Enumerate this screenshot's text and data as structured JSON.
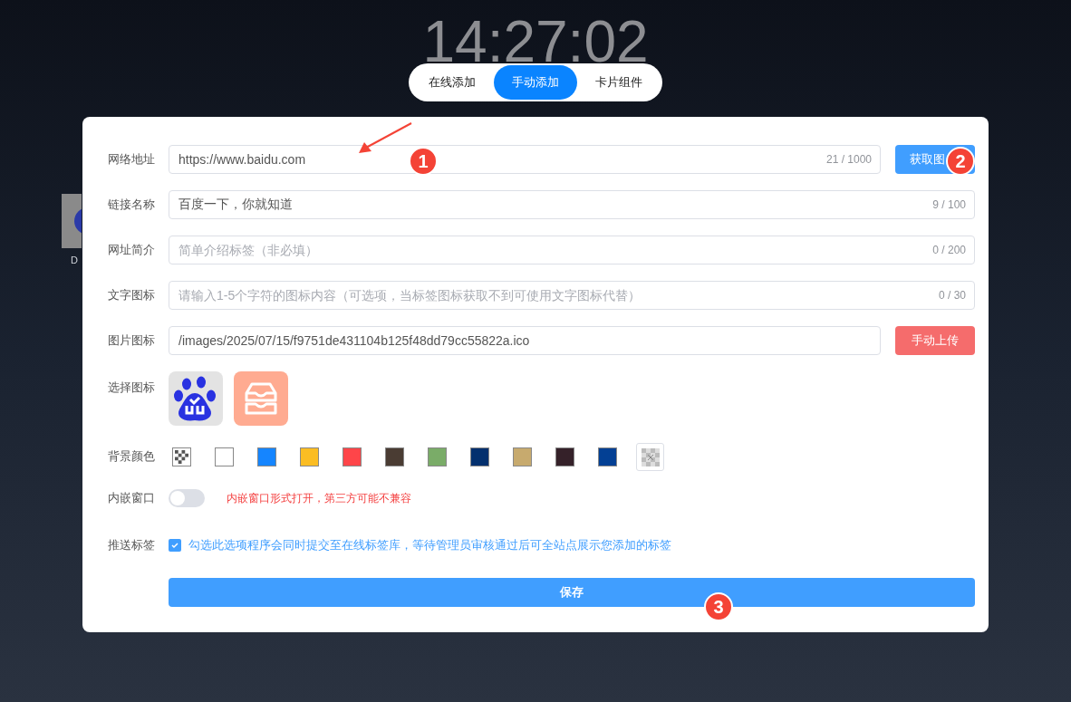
{
  "clock": "14:27:02",
  "desktop_icon": {
    "label": "D"
  },
  "tabs": [
    {
      "label": "在线添加",
      "selected": false
    },
    {
      "label": "手动添加",
      "selected": true
    },
    {
      "label": "卡片组件",
      "selected": false
    }
  ],
  "form": {
    "url": {
      "label": "网络地址",
      "value": "https://www.baidu.com",
      "count": "21 / 1000",
      "button": "获取图"
    },
    "name": {
      "label": "链接名称",
      "value": "百度一下，你就知道",
      "count": "9 / 100"
    },
    "intro": {
      "label": "网址简介",
      "placeholder": "简单介绍标签（非必填）",
      "count": "0 / 200"
    },
    "text_icon": {
      "label": "文字图标",
      "placeholder": "请输入1-5个字符的图标内容（可选项，当标签图标获取不到可使用文字图标代替）",
      "count": "0 / 30"
    },
    "image_icon": {
      "label": "图片图标",
      "value": "/images/2025/07/15/f9751de431104b125f48dd79cc55822a.ico",
      "button": "手动上传"
    },
    "choose_icon": {
      "label": "选择图标",
      "options": [
        {
          "kind": "paw"
        },
        {
          "kind": "tray"
        }
      ]
    },
    "bg_color": {
      "label": "背景颜色",
      "swatches": [
        {
          "kind": "transparent"
        },
        {
          "kind": "solid",
          "color": "#ffffff"
        },
        {
          "kind": "solid",
          "color": "#1585ff"
        },
        {
          "kind": "solid",
          "color": "#fbbd23"
        },
        {
          "kind": "solid",
          "color": "#fe4549"
        },
        {
          "kind": "solid",
          "color": "#4a3c33"
        },
        {
          "kind": "solid",
          "color": "#7aac68"
        },
        {
          "kind": "solid",
          "color": "#03306e"
        },
        {
          "kind": "solid",
          "color": "#c7aa6e"
        },
        {
          "kind": "solid",
          "color": "#352129"
        },
        {
          "kind": "solid",
          "color": "#034094"
        },
        {
          "kind": "custom"
        }
      ]
    },
    "embed": {
      "label": "内嵌窗口",
      "on": false,
      "hint": "内嵌窗口形式打开，第三方可能不兼容"
    },
    "push": {
      "label": "推送标签",
      "checked": true,
      "text": "勾选此选项程序会同时提交至在线标签库，等待管理员审核通过后可全站点展示您添加的标签"
    },
    "save": "保存"
  },
  "annotations": [
    "1",
    "2",
    "3"
  ]
}
